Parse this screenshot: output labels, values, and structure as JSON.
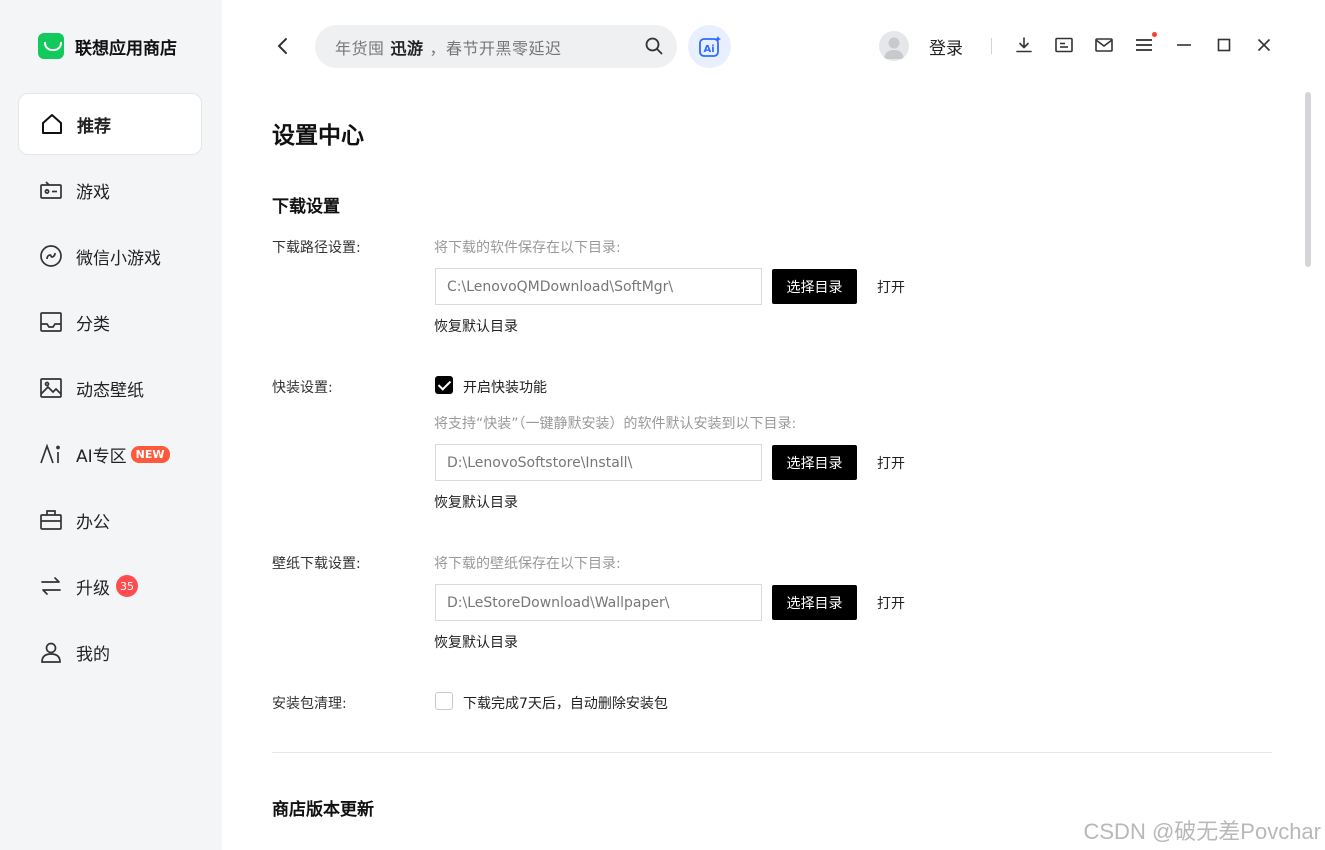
{
  "app": {
    "name": "联想应用商店"
  },
  "sidebar": {
    "items": [
      {
        "label": "推荐",
        "icon": "home-icon",
        "active": true
      },
      {
        "label": "游戏",
        "icon": "game-icon"
      },
      {
        "label": "微信小游戏",
        "icon": "wechat-game-icon"
      },
      {
        "label": "分类",
        "icon": "category-icon"
      },
      {
        "label": "动态壁纸",
        "icon": "wallpaper-icon"
      },
      {
        "label": "AI专区",
        "icon": "ai-icon",
        "badge": "NEW"
      },
      {
        "label": "办公",
        "icon": "briefcase-icon"
      },
      {
        "label": "升级",
        "icon": "upgrade-icon",
        "badge": "35"
      },
      {
        "label": "我的",
        "icon": "user-icon"
      }
    ]
  },
  "topbar": {
    "search": {
      "prefix": "年货囤",
      "highlight": "迅游",
      "suffix": "，春节开黑零延迟"
    },
    "ai_label": "Ai",
    "login_label": "登录"
  },
  "settings": {
    "page_title": "设置中心",
    "download_section": {
      "title": "下载设置",
      "download_path": {
        "label": "下载路径设置:",
        "hint": "将下载的软件保存在以下目录:",
        "value": "C:\\LenovoQMDownload\\SoftMgr\\",
        "choose_label": "选择目录",
        "open_label": "打开",
        "restore_label": "恢复默认目录"
      },
      "quick_install": {
        "label": "快装设置:",
        "enable_label": "开启快装功能",
        "enabled": true,
        "hint": "将支持“快装”（一键静默安装）的软件默认安装到以下目录:",
        "value": "D:\\LenovoSoftstore\\Install\\",
        "choose_label": "选择目录",
        "open_label": "打开",
        "restore_label": "恢复默认目录"
      },
      "wallpaper_path": {
        "label": "壁纸下载设置:",
        "hint": "将下载的壁纸保存在以下目录:",
        "value": "D:\\LeStoreDownload\\Wallpaper\\",
        "choose_label": "选择目录",
        "open_label": "打开",
        "restore_label": "恢复默认目录"
      },
      "package_cleanup": {
        "label": "安装包清理:",
        "option_label": "下载完成7天后，自动删除安装包",
        "enabled": false
      }
    },
    "store_update_section": {
      "title": "商店版本更新"
    }
  },
  "watermark": "CSDN @破无差Povchar",
  "colors": {
    "accent": "#12c95c",
    "badge_red": "#ff4d4f",
    "button_dark": "#000000"
  }
}
